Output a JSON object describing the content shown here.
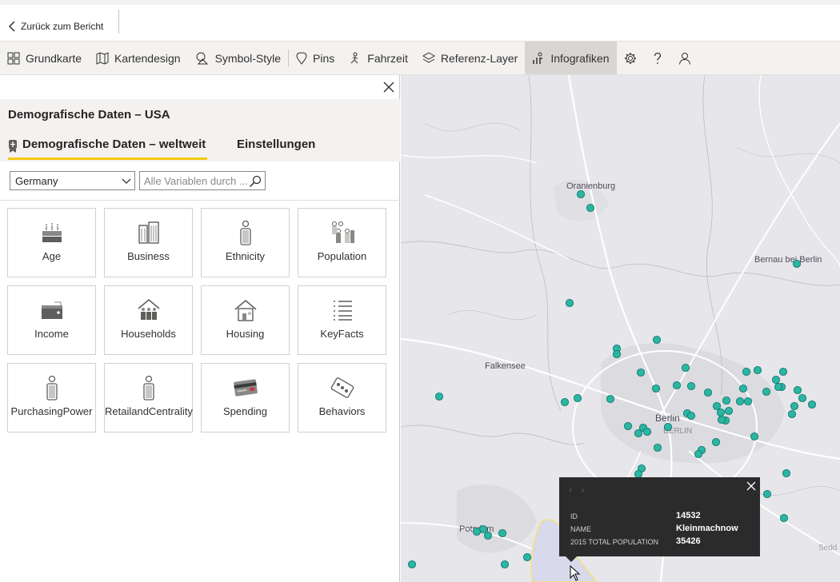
{
  "topbar": {
    "back_label": "Zurück zum Bericht"
  },
  "toolbar": {
    "items": [
      {
        "label": "Grundkarte",
        "icon": "grid-icon"
      },
      {
        "label": "Kartendesign",
        "icon": "map-icon"
      },
      {
        "label": "Symbol-Style",
        "icon": "symbol-style-icon"
      },
      {
        "label": "Pins",
        "icon": "pin-icon"
      },
      {
        "label": "Fahrzeit",
        "icon": "travel-time-icon"
      },
      {
        "label": "Referenz-Layer",
        "icon": "layers-icon"
      },
      {
        "label": "Infografiken",
        "icon": "infographic-icon",
        "active": true
      }
    ],
    "icon_buttons": [
      "gear-icon",
      "help-icon",
      "user-icon"
    ]
  },
  "panel": {
    "title": "Demografische Daten – USA",
    "tab_world": "Demografische Daten – weltweit",
    "tab_settings": "Einstellungen",
    "country": "Germany",
    "search_placeholder": "Alle Variablen durch ...",
    "tiles": [
      {
        "label": "Age",
        "icon": "birthday-cake-icon"
      },
      {
        "label": "Business",
        "icon": "buildings-icon"
      },
      {
        "label": "Ethnicity",
        "icon": "person-icon"
      },
      {
        "label": "Population",
        "icon": "group-icon"
      },
      {
        "label": "Income",
        "icon": "wallet-icon"
      },
      {
        "label": "Households",
        "icon": "household-icon"
      },
      {
        "label": "Housing",
        "icon": "house-icon"
      },
      {
        "label": "KeyFacts",
        "icon": "list-icon"
      },
      {
        "label": "PurchasingPower",
        "icon": "person-icon"
      },
      {
        "label": "RetailandCentrality",
        "icon": "person-icon"
      },
      {
        "label": "Spending",
        "icon": "credit-card-icon"
      },
      {
        "label": "Behaviors",
        "icon": "behaviors-icon"
      }
    ]
  },
  "map": {
    "cities": [
      "Oranienburg",
      "Bernau bei Berlin",
      "Falkensee",
      "Berlin",
      "BERLIN",
      "Potsdam",
      "Sedd"
    ],
    "point_color": "#2bb5a3"
  },
  "popup": {
    "rows": [
      {
        "label": "ID",
        "value": "14532"
      },
      {
        "label": "NAME",
        "value": "Kleinmachnow"
      },
      {
        "label": "2015 TOTAL POPULATION",
        "value": "35426"
      }
    ]
  }
}
